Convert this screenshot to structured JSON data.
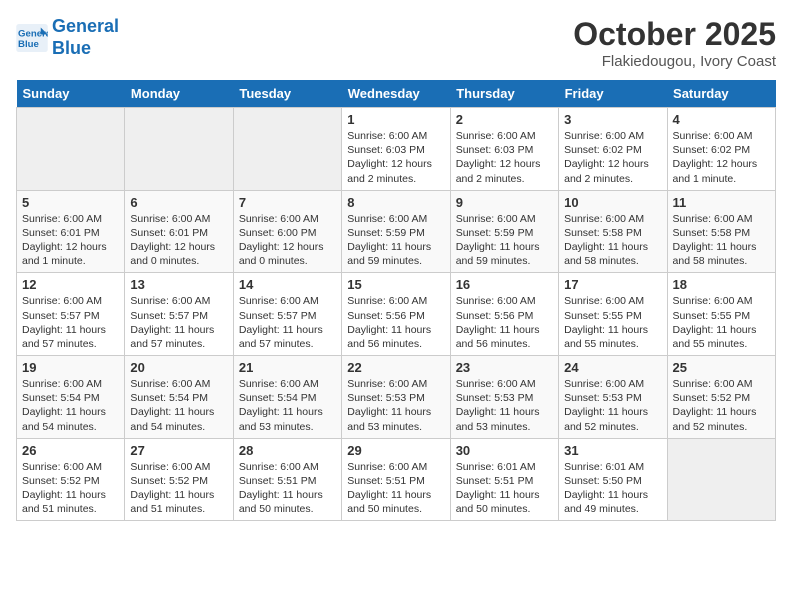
{
  "header": {
    "logo_line1": "General",
    "logo_line2": "Blue",
    "month": "October 2025",
    "location": "Flakiedougou, Ivory Coast"
  },
  "weekdays": [
    "Sunday",
    "Monday",
    "Tuesday",
    "Wednesday",
    "Thursday",
    "Friday",
    "Saturday"
  ],
  "weeks": [
    [
      {
        "day": "",
        "info": ""
      },
      {
        "day": "",
        "info": ""
      },
      {
        "day": "",
        "info": ""
      },
      {
        "day": "1",
        "info": "Sunrise: 6:00 AM\nSunset: 6:03 PM\nDaylight: 12 hours and 2 minutes."
      },
      {
        "day": "2",
        "info": "Sunrise: 6:00 AM\nSunset: 6:03 PM\nDaylight: 12 hours and 2 minutes."
      },
      {
        "day": "3",
        "info": "Sunrise: 6:00 AM\nSunset: 6:02 PM\nDaylight: 12 hours and 2 minutes."
      },
      {
        "day": "4",
        "info": "Sunrise: 6:00 AM\nSunset: 6:02 PM\nDaylight: 12 hours and 1 minute."
      }
    ],
    [
      {
        "day": "5",
        "info": "Sunrise: 6:00 AM\nSunset: 6:01 PM\nDaylight: 12 hours and 1 minute."
      },
      {
        "day": "6",
        "info": "Sunrise: 6:00 AM\nSunset: 6:01 PM\nDaylight: 12 hours and 0 minutes."
      },
      {
        "day": "7",
        "info": "Sunrise: 6:00 AM\nSunset: 6:00 PM\nDaylight: 12 hours and 0 minutes."
      },
      {
        "day": "8",
        "info": "Sunrise: 6:00 AM\nSunset: 5:59 PM\nDaylight: 11 hours and 59 minutes."
      },
      {
        "day": "9",
        "info": "Sunrise: 6:00 AM\nSunset: 5:59 PM\nDaylight: 11 hours and 59 minutes."
      },
      {
        "day": "10",
        "info": "Sunrise: 6:00 AM\nSunset: 5:58 PM\nDaylight: 11 hours and 58 minutes."
      },
      {
        "day": "11",
        "info": "Sunrise: 6:00 AM\nSunset: 5:58 PM\nDaylight: 11 hours and 58 minutes."
      }
    ],
    [
      {
        "day": "12",
        "info": "Sunrise: 6:00 AM\nSunset: 5:57 PM\nDaylight: 11 hours and 57 minutes."
      },
      {
        "day": "13",
        "info": "Sunrise: 6:00 AM\nSunset: 5:57 PM\nDaylight: 11 hours and 57 minutes."
      },
      {
        "day": "14",
        "info": "Sunrise: 6:00 AM\nSunset: 5:57 PM\nDaylight: 11 hours and 57 minutes."
      },
      {
        "day": "15",
        "info": "Sunrise: 6:00 AM\nSunset: 5:56 PM\nDaylight: 11 hours and 56 minutes."
      },
      {
        "day": "16",
        "info": "Sunrise: 6:00 AM\nSunset: 5:56 PM\nDaylight: 11 hours and 56 minutes."
      },
      {
        "day": "17",
        "info": "Sunrise: 6:00 AM\nSunset: 5:55 PM\nDaylight: 11 hours and 55 minutes."
      },
      {
        "day": "18",
        "info": "Sunrise: 6:00 AM\nSunset: 5:55 PM\nDaylight: 11 hours and 55 minutes."
      }
    ],
    [
      {
        "day": "19",
        "info": "Sunrise: 6:00 AM\nSunset: 5:54 PM\nDaylight: 11 hours and 54 minutes."
      },
      {
        "day": "20",
        "info": "Sunrise: 6:00 AM\nSunset: 5:54 PM\nDaylight: 11 hours and 54 minutes."
      },
      {
        "day": "21",
        "info": "Sunrise: 6:00 AM\nSunset: 5:54 PM\nDaylight: 11 hours and 53 minutes."
      },
      {
        "day": "22",
        "info": "Sunrise: 6:00 AM\nSunset: 5:53 PM\nDaylight: 11 hours and 53 minutes."
      },
      {
        "day": "23",
        "info": "Sunrise: 6:00 AM\nSunset: 5:53 PM\nDaylight: 11 hours and 53 minutes."
      },
      {
        "day": "24",
        "info": "Sunrise: 6:00 AM\nSunset: 5:53 PM\nDaylight: 11 hours and 52 minutes."
      },
      {
        "day": "25",
        "info": "Sunrise: 6:00 AM\nSunset: 5:52 PM\nDaylight: 11 hours and 52 minutes."
      }
    ],
    [
      {
        "day": "26",
        "info": "Sunrise: 6:00 AM\nSunset: 5:52 PM\nDaylight: 11 hours and 51 minutes."
      },
      {
        "day": "27",
        "info": "Sunrise: 6:00 AM\nSunset: 5:52 PM\nDaylight: 11 hours and 51 minutes."
      },
      {
        "day": "28",
        "info": "Sunrise: 6:00 AM\nSunset: 5:51 PM\nDaylight: 11 hours and 50 minutes."
      },
      {
        "day": "29",
        "info": "Sunrise: 6:00 AM\nSunset: 5:51 PM\nDaylight: 11 hours and 50 minutes."
      },
      {
        "day": "30",
        "info": "Sunrise: 6:01 AM\nSunset: 5:51 PM\nDaylight: 11 hours and 50 minutes."
      },
      {
        "day": "31",
        "info": "Sunrise: 6:01 AM\nSunset: 5:50 PM\nDaylight: 11 hours and 49 minutes."
      },
      {
        "day": "",
        "info": ""
      }
    ]
  ]
}
